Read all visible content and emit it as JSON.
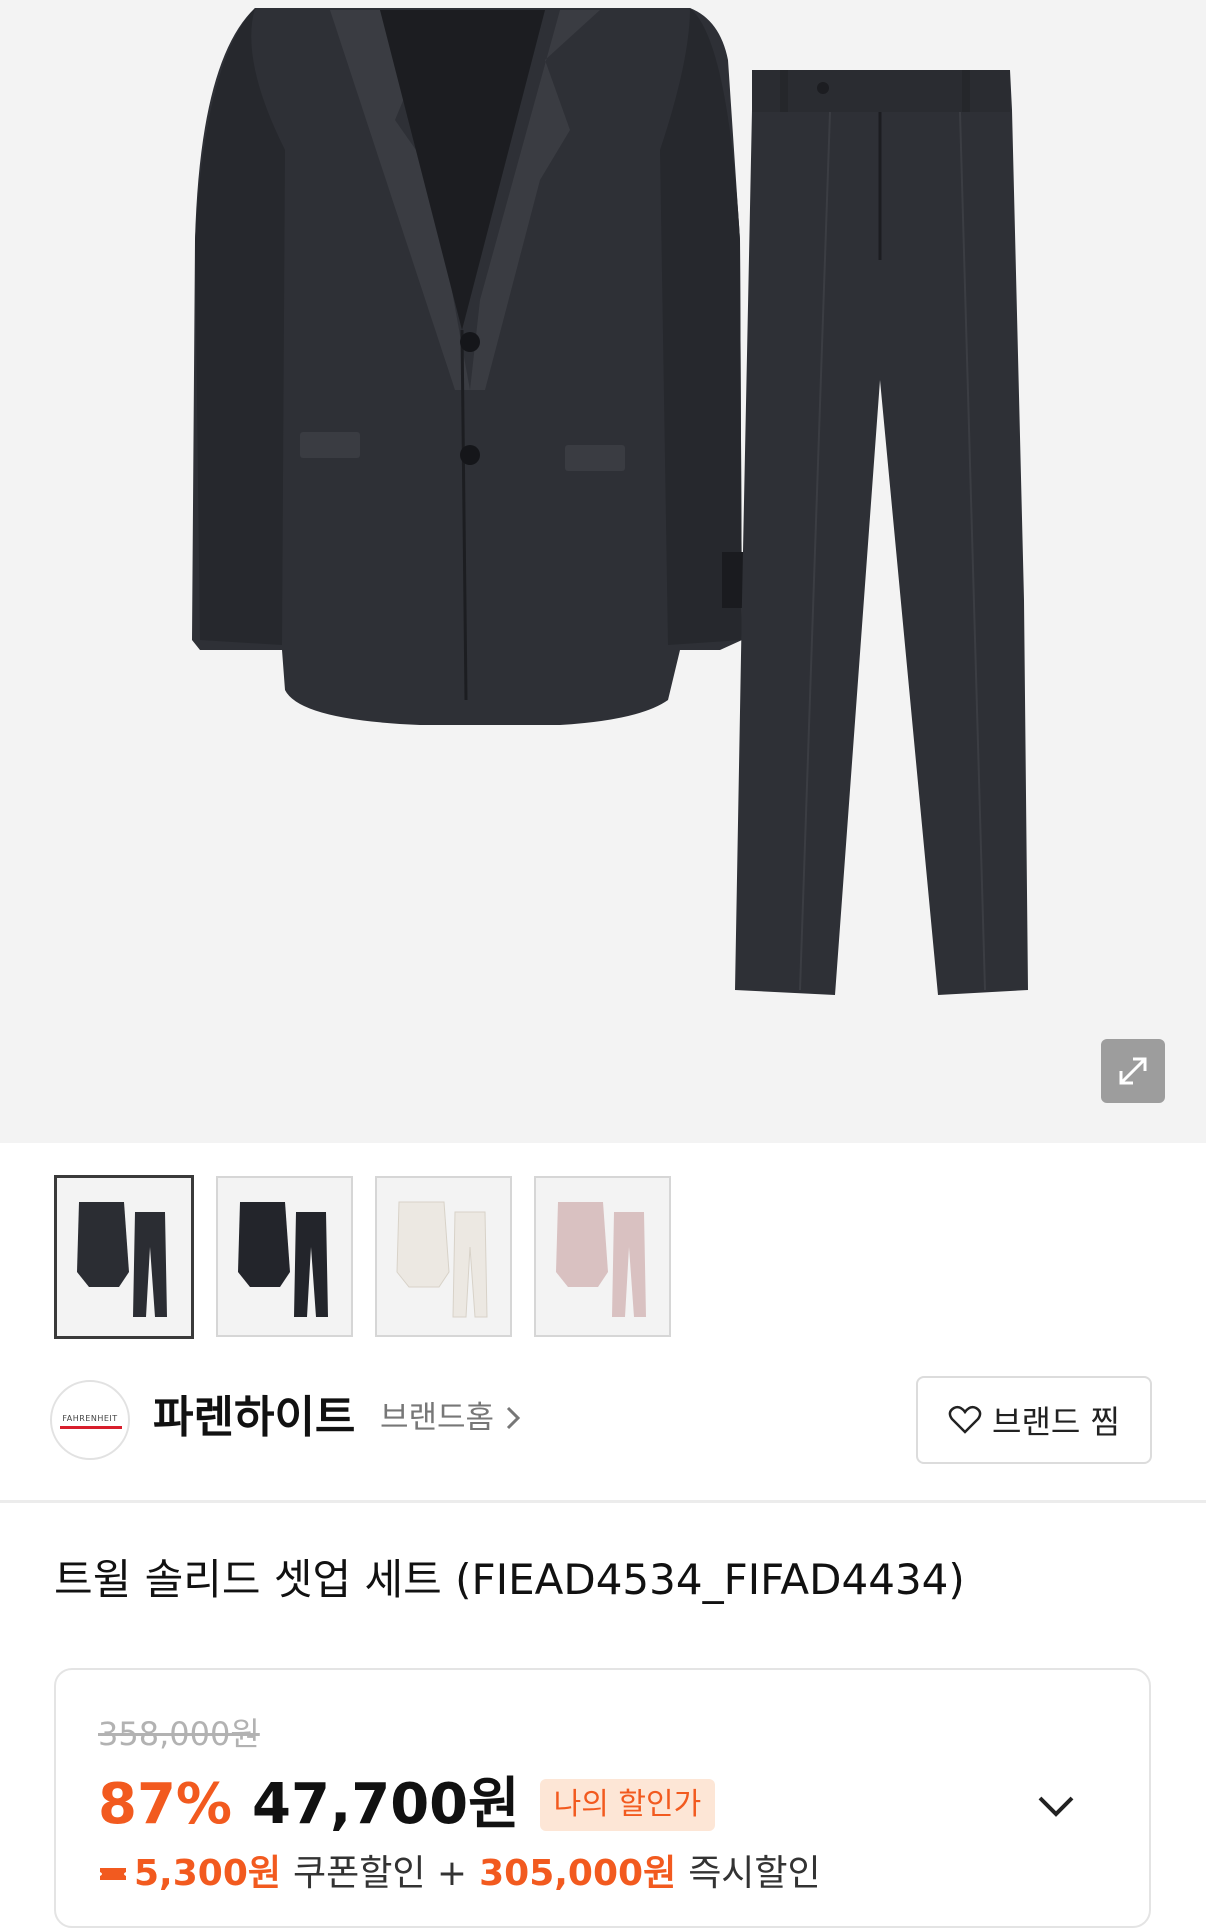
{
  "gallery": {
    "expand_icon": "expand-icon",
    "thumbnails": [
      {
        "color": "#2b2d33",
        "selected": true
      },
      {
        "color": "#23252b",
        "selected": false
      },
      {
        "color": "#ece8e2",
        "selected": false
      },
      {
        "color": "#d9c1c1",
        "selected": false
      }
    ]
  },
  "brand": {
    "logo_text": "FAHRENHEIT",
    "name": "파렌하이트",
    "home_label": "브랜드홈",
    "favorite_label": "브랜드 찜"
  },
  "product": {
    "title": "트윌 솔리드 셋업 세트 (FIEAD4534_FIFAD4434)"
  },
  "price": {
    "original": "358,000원",
    "discount_rate": "87%",
    "sale": "47,700원",
    "my_price_badge": "나의 할인가",
    "coupon_amount": "5,300원",
    "coupon_label": "쿠폰할인 +",
    "instant_amount": "305,000원",
    "instant_label": "즉시할인"
  },
  "colors": {
    "accent": "#f25a1f",
    "badge_bg": "#fde6d6"
  }
}
